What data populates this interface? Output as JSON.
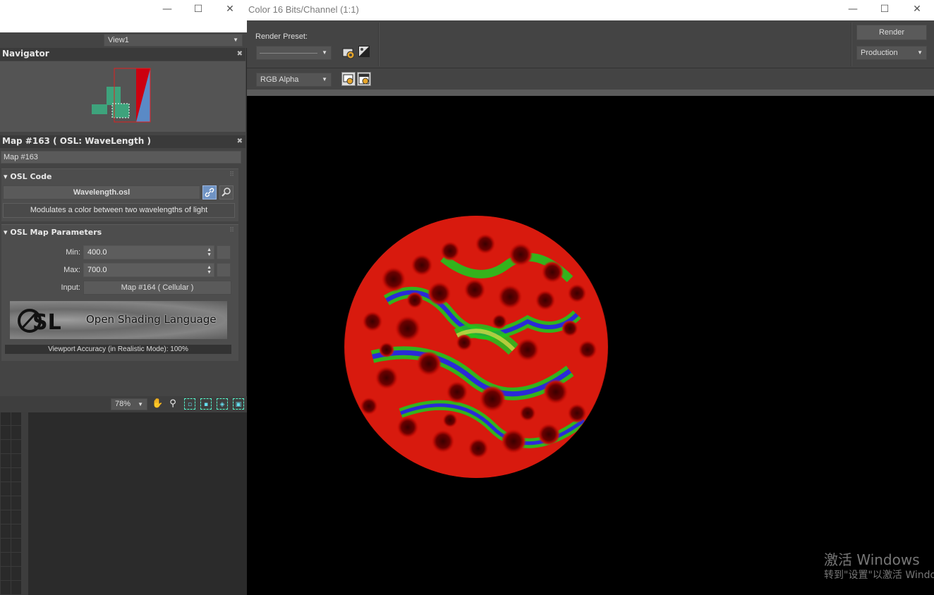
{
  "render_window": {
    "title": "Color 16 Bits/Channel (1:1)",
    "render_preset_label": "Render Preset:",
    "render_preset_value": "",
    "render_button": "Render",
    "production_value": "Production",
    "channel_value": "RGB Alpha"
  },
  "window_controls": {
    "minimize": "—",
    "maximize": "☐",
    "close": "✕"
  },
  "material_editor": {
    "view_value": "View1",
    "navigator_title": "Navigator",
    "map_panel_title": "Map #163  ( OSL: WaveLength )",
    "map_name": "Map #163",
    "osl_code": {
      "title": "OSL Code",
      "file_button": "Wavelength.osl",
      "description": "Modulates a color between two wavelengths of light"
    },
    "osl_params": {
      "title": "OSL Map Parameters",
      "min_label": "Min:",
      "min_value": "400.0",
      "max_label": "Max:",
      "max_value": "700.0",
      "input_label": "Input:",
      "input_value": "Map #164  ( Cellular )"
    },
    "logo_text": "Open Shading Language",
    "viewport_accuracy": "Viewport Accuracy (in Realistic Mode): 100%",
    "zoom_value": "78%"
  },
  "watermark": {
    "line1": "激活 Windows",
    "line2": "转到\"设置\"以激活 Windo"
  },
  "icons": [
    "settings-gear-icon",
    "environment-icon",
    "display-channel-icon",
    "render-clone-icon",
    "link-icon",
    "search-icon",
    "hand-pan-icon",
    "zoom-icon",
    "zoom-region-icon",
    "zoom-extents-icon",
    "zoom-all-icon",
    "fit-icon"
  ],
  "colors": {
    "panel_bg": "#444444",
    "canvas_bg": "#000000",
    "sphere_red": "#d81a0e",
    "sphere_green": "#22c41e",
    "sphere_blue": "#2a2ad8"
  }
}
